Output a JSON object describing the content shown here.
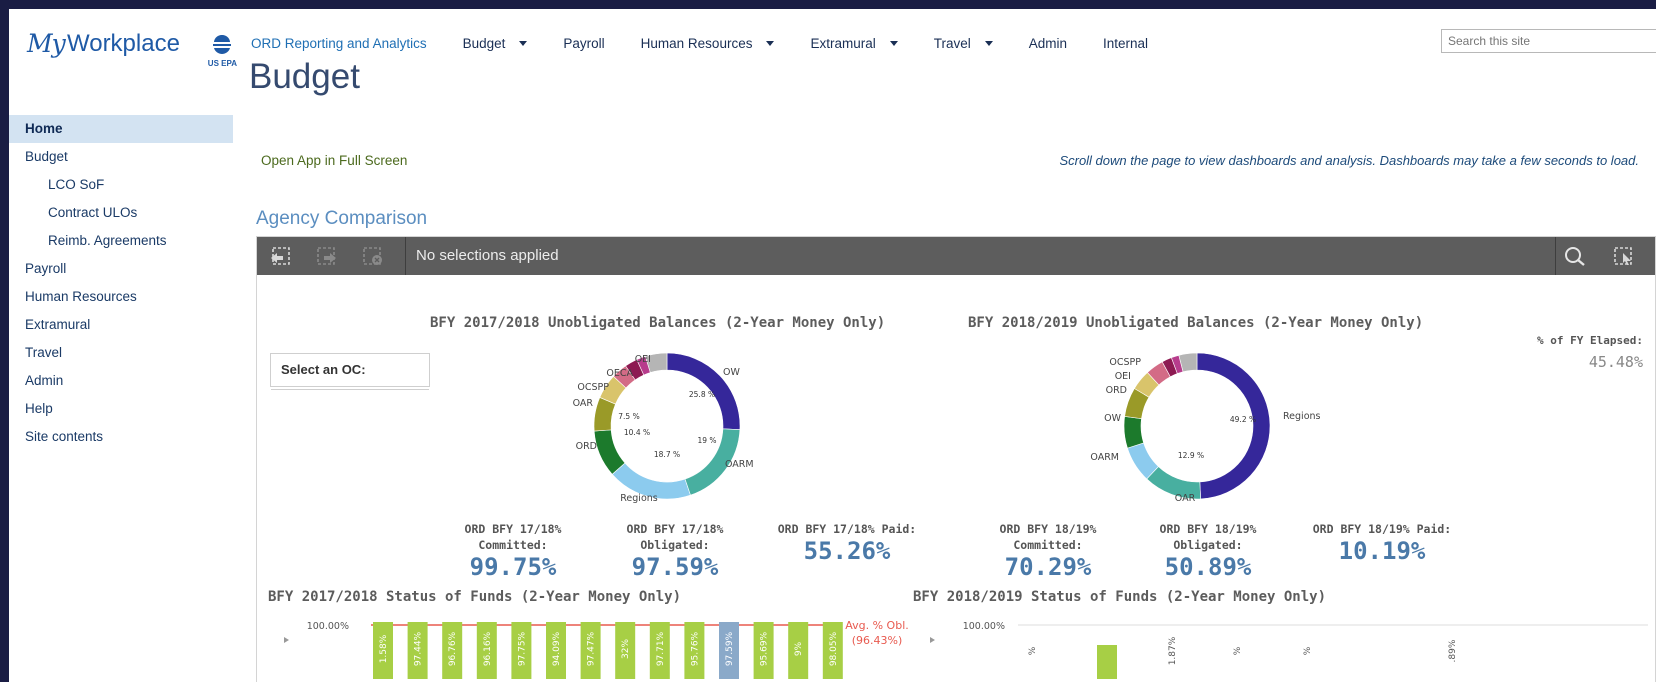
{
  "logo": {
    "my": "My",
    "workplace": "Workplace",
    "sub": "US EPA"
  },
  "topnav": [
    {
      "label": "ORD Reporting and Analytics",
      "dropdown": false
    },
    {
      "label": "Budget",
      "dropdown": true
    },
    {
      "label": "Payroll",
      "dropdown": false
    },
    {
      "label": "Human Resources",
      "dropdown": true
    },
    {
      "label": "Extramural",
      "dropdown": true
    },
    {
      "label": "Travel",
      "dropdown": true
    },
    {
      "label": "Admin",
      "dropdown": false
    },
    {
      "label": "Internal",
      "dropdown": false
    }
  ],
  "search": {
    "placeholder": "Search this site"
  },
  "page_title": "Budget",
  "leftnav": [
    {
      "label": "Home",
      "level": 0,
      "active": true
    },
    {
      "label": "Budget",
      "level": 0
    },
    {
      "label": "LCO SoF",
      "level": 1
    },
    {
      "label": "Contract ULOs",
      "level": 1
    },
    {
      "label": "Reimb. Agreements",
      "level": 1
    },
    {
      "label": "Payroll",
      "level": 0
    },
    {
      "label": "Human Resources",
      "level": 0
    },
    {
      "label": "Extramural",
      "level": 0
    },
    {
      "label": "Travel",
      "level": 0
    },
    {
      "label": "Admin",
      "level": 0
    },
    {
      "label": "Help",
      "level": 0
    },
    {
      "label": "Site contents",
      "level": 0
    }
  ],
  "open_full_screen": "Open App in Full Screen",
  "scroll_note": "Scroll down the page to view dashboards and analysis. Dashboards may take a few seconds to load.",
  "section_title": "Agency Comparison",
  "qlik": {
    "selection_text": "No selections applied",
    "select_oc_label": "Select an OC:",
    "fy_elapsed": {
      "label": "% of FY Elapsed:",
      "value": "45.48%"
    },
    "donut1_title": "BFY 2017/2018 Unobligated Balances (2-Year Money Only)",
    "donut2_title": "BFY 2018/2019 Unobligated Balances (2-Year Money Only)",
    "kpis_1718": [
      {
        "label1": "ORD BFY 17/18%",
        "label2": "Committed:",
        "value": "99.75%"
      },
      {
        "label1": "ORD BFY 17/18%",
        "label2": "Obligated:",
        "value": "97.59%"
      },
      {
        "label1": "ORD BFY 17/18% Paid:",
        "label2": "",
        "value": "55.26%"
      }
    ],
    "kpis_1819": [
      {
        "label1": "ORD BFY 18/19%",
        "label2": "Committed:",
        "value": "70.29%"
      },
      {
        "label1": "ORD BFY 18/19%",
        "label2": "Obligated:",
        "value": "50.89%"
      },
      {
        "label1": "ORD BFY 18/19% Paid:",
        "label2": "",
        "value": "10.19%"
      }
    ],
    "sof1_title": "BFY 2017/2018 Status of Funds (2-Year Money Only)",
    "sof2_title": "BFY 2018/2019 Status of Funds (2-Year Money Only)",
    "sof1": {
      "ytick": "100.00%",
      "avg_label_1": "Avg. % Obl.",
      "avg_label_2": "(96.43%)"
    },
    "sof2": {
      "ytick": "100.00%"
    }
  },
  "chart_data": [
    {
      "type": "pie",
      "title": "BFY 2017/2018 Unobligated Balances (2-Year Money Only)",
      "slices": [
        {
          "label": "OW",
          "value": 25.8,
          "color": "#35279a"
        },
        {
          "label": "OARM",
          "value": 19.0,
          "color": "#48afa0"
        },
        {
          "label": "Regions",
          "value": 18.7,
          "color": "#8ccbee"
        },
        {
          "label": "ORD",
          "value": 10.4,
          "color": "#1c7a2c"
        },
        {
          "label": "OAR",
          "value": 7.5,
          "color": "#9a9a28"
        },
        {
          "label": "OCSPP",
          "value": 5.5,
          "color": "#d9c46b"
        },
        {
          "label": "OECA",
          "value": 3.5,
          "color": "#d36b86"
        },
        {
          "label": "OEI",
          "value": 2.8,
          "color": "#8d1a52"
        },
        {
          "label": "",
          "value": 2.0,
          "color": "#b73c8c"
        },
        {
          "label": "",
          "value": 4.8,
          "color": "#b5b5b5"
        }
      ],
      "data_labels": [
        "25.8 %",
        "19 %",
        "18.7 %",
        "10.4 %",
        "7.5 %"
      ]
    },
    {
      "type": "pie",
      "title": "BFY 2018/2019 Unobligated Balances (2-Year Money Only)",
      "slices": [
        {
          "label": "Regions",
          "value": 49.2,
          "color": "#35279a"
        },
        {
          "label": "OAR",
          "value": 12.9,
          "color": "#48afa0"
        },
        {
          "label": "OARM",
          "value": 8.0,
          "color": "#8ccbee"
        },
        {
          "label": "OW",
          "value": 7.0,
          "color": "#1c7a2c"
        },
        {
          "label": "ORD",
          "value": 6.5,
          "color": "#9a9a28"
        },
        {
          "label": "OEI",
          "value": 4.5,
          "color": "#d9c46b"
        },
        {
          "label": "OCSPP",
          "value": 4.0,
          "color": "#d36b86"
        },
        {
          "label": "",
          "value": 2.2,
          "color": "#8d1a52"
        },
        {
          "label": "",
          "value": 1.7,
          "color": "#b73c8c"
        },
        {
          "label": "",
          "value": 4.0,
          "color": "#b5b5b5"
        }
      ],
      "data_labels": [
        "49.2 %",
        "12.9 %"
      ]
    },
    {
      "type": "bar",
      "title": "BFY 2017/2018 Status of Funds (2-Year Money Only)",
      "ytick_top": "100.00%",
      "avg_line": 96.43,
      "avg_label": "Avg. % Obl. (96.43%)",
      "bar_labels": [
        "1.58%",
        "97.44%",
        "96.76%",
        "96.16%",
        "97.75%",
        "94.09%",
        "97.47%",
        "32%",
        "97.71%",
        "95.76%",
        "97.59%",
        "95.69%",
        "9%",
        "98.05%"
      ],
      "highlight_index": 10
    },
    {
      "type": "bar",
      "title": "BFY 2018/2019 Status of Funds (2-Year Money Only)",
      "ytick_top": "100.00%",
      "bar_labels": [
        "%",
        "",
        "1.87%",
        "%",
        "%",
        ".89%"
      ]
    }
  ]
}
